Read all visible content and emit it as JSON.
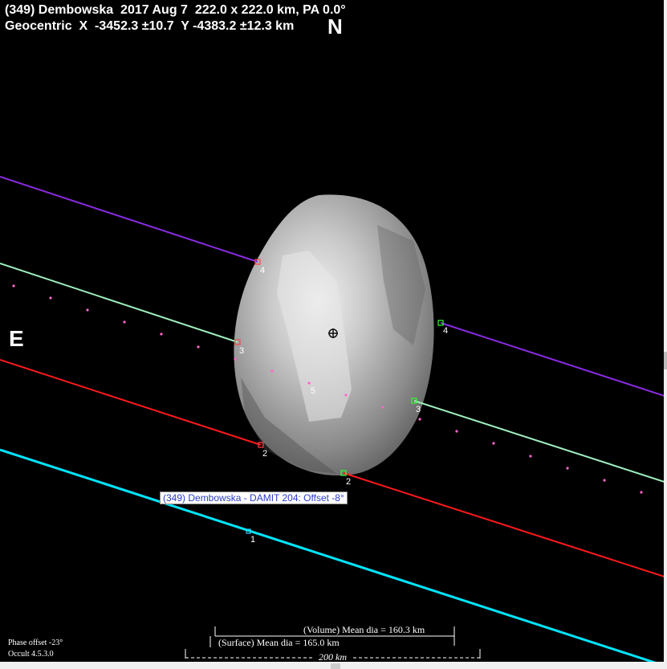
{
  "header": {
    "line1": "(349) Dembowska  2017 Aug 7  222.0 x 222.0 km, PA 0.0°",
    "line2": "Geocentric  X  -3452.3 ±10.7  Y -4383.2 ±12.3 km"
  },
  "compass": {
    "north": "N",
    "east": "E"
  },
  "model_label": "(349) Dembowska - DAMIT 204: Offset -8°",
  "chords": [
    {
      "id": "1",
      "label": "1",
      "color": "#00e5ff"
    },
    {
      "id": "2",
      "label": "2",
      "color": "#ff1a1a"
    },
    {
      "id": "3",
      "label": "3",
      "color": "#9ff0c0"
    },
    {
      "id": "4",
      "label": "4",
      "color": "#8a2be2"
    },
    {
      "id": "5",
      "label": "5",
      "color": "#ff66cc"
    }
  ],
  "diameters": {
    "volume": "(Volume) Mean dia = 160.3 km",
    "surface": "(Surface) Mean dia = 165.0 km"
  },
  "scale_label": "200 km",
  "footer": {
    "phase_offset": "Phase offset -23°",
    "version": "Occult 4.5.3.0"
  },
  "colors": {
    "background": "#000000",
    "text": "#ffffff",
    "label_text": "#2a3cc8",
    "asteroid": "#9a9a9a"
  }
}
